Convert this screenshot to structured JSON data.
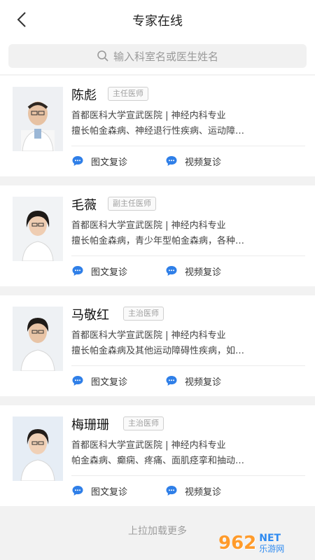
{
  "header": {
    "title": "专家在线"
  },
  "search": {
    "placeholder": "输入科室名或医生姓名"
  },
  "doctors": [
    {
      "name": "陈彪",
      "title": "主任医师",
      "hospital": "首都医科大学宣武医院 | 神经内科专业",
      "specialty": "擅长帕金森病、神经退行性疾病、运动障…",
      "action1": "图文复诊",
      "action2": "视频复诊"
    },
    {
      "name": "毛薇",
      "title": "副主任医师",
      "hospital": "首都医科大学宣武医院 | 神经内科专业",
      "specialty": "擅长帕金森病，青少年型帕金森病，各种…",
      "action1": "图文复诊",
      "action2": "视频复诊"
    },
    {
      "name": "马敬红",
      "title": "主治医师",
      "hospital": "首都医科大学宣武医院 | 神经内科专业",
      "specialty": "擅长帕金森病及其他运动障碍性疾病，如…",
      "action1": "图文复诊",
      "action2": "视频复诊"
    },
    {
      "name": "梅珊珊",
      "title": "主治医师",
      "hospital": "首都医科大学宣武医院 | 神经内科专业",
      "specialty": "帕金森病、癫痫、疼痛、面肌痉挛和抽动…",
      "action1": "图文复诊",
      "action2": "视频复诊"
    }
  ],
  "footer": {
    "load_more": "上拉加载更多"
  },
  "watermark": {
    "number": "962",
    "brand": "NET",
    "site": "乐游网"
  }
}
